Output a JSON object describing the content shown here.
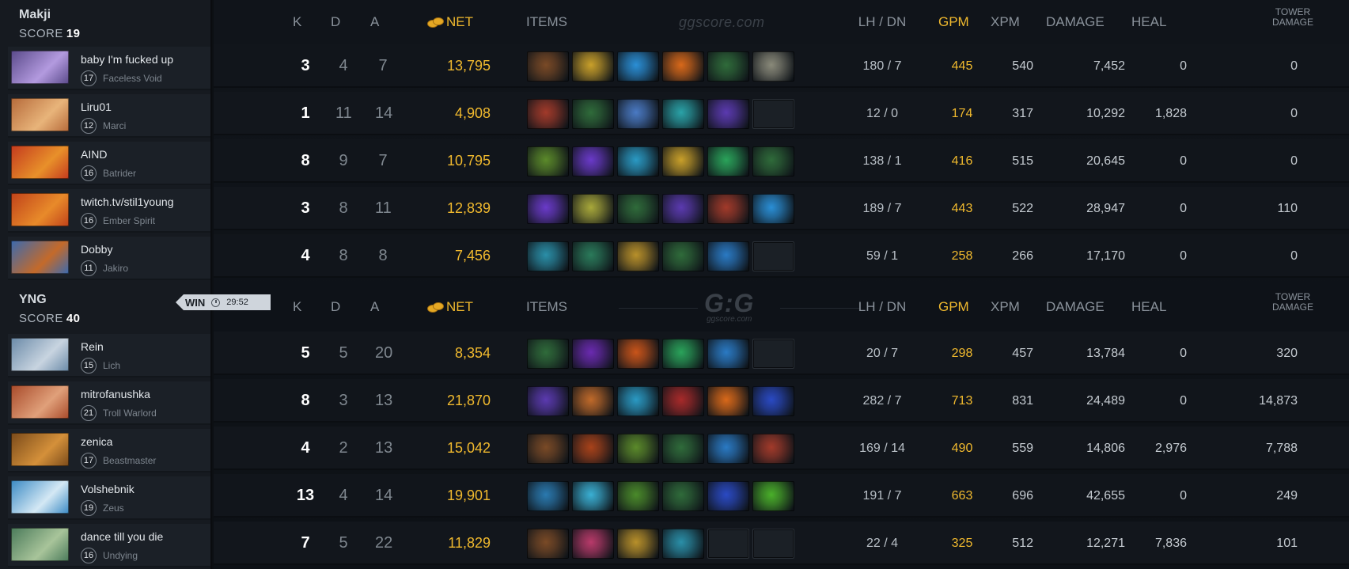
{
  "headers": {
    "k": "K",
    "d": "D",
    "a": "A",
    "net": "NET",
    "items": "ITEMS",
    "lhdn": "LH / DN",
    "gpm": "GPM",
    "xpm": "XPM",
    "damage": "DAMAGE",
    "heal": "HEAL",
    "tower_damage_1": "TOWER",
    "tower_damage_2": "DAMAGE",
    "watermark": "ggscore.com",
    "logo_big": "G:G",
    "logo_small": "ggscore.com"
  },
  "colors": {
    "gold": "#f0b92e",
    "sidebar": "#161a20",
    "background": "#0c0f13"
  },
  "win_tag": {
    "label": "WIN",
    "time": "29:52",
    "icon": "clock-icon"
  },
  "teams": [
    {
      "name": "Makji",
      "score_label": "SCORE",
      "score": "19",
      "players": [
        {
          "name": "baby I'm fucked up",
          "level": "17",
          "hero": "Faceless Void",
          "portrait": "#5a4a8a,#b39adf",
          "k": "3",
          "d": "4",
          "a": "7",
          "net": "13,795",
          "items": [
            "boots-item#7a4a26",
            "gold-helm-item#c9a02a",
            "blue-orb-item#2a8fd6",
            "fire-orb-item#d9691a",
            "green-dagger-item#2f6b3a",
            "scythe-item#8a8a7a"
          ],
          "lhdn": "180  /  7",
          "gpm": "445",
          "xpm": "540",
          "damage": "7,452",
          "heal": "0",
          "tower": "0"
        },
        {
          "name": "Liru01",
          "level": "12",
          "hero": "Marci",
          "portrait": "#b66a3a,#e8b47a",
          "k": "1",
          "d": "11",
          "a": "14",
          "net": "4,908",
          "items": [
            "axe-item#a23a2a",
            "green-dagger-item#2f6b3a",
            "potion-item#4a7ac4",
            "blob-item#2aa3a8",
            "purple-cloak-item#5b3ab0",
            "empty"
          ],
          "lhdn": "12  /  0",
          "gpm": "174",
          "xpm": "317",
          "damage": "10,292",
          "heal": "1,828",
          "tower": "0"
        },
        {
          "name": "AIND",
          "level": "16",
          "hero": "Batrider",
          "portrait": "#c43a1e,#e8902a",
          "k": "8",
          "d": "9",
          "a": "7",
          "net": "10,795",
          "items": [
            "lotus-item#5b8a2a",
            "purple-blade-item#6a3ac9",
            "ice-axe-item#2a9ac4",
            "gold-helm-item#c9a02a",
            "green-boots-item#2aa35a",
            "green-dagger-item#2f6b3a"
          ],
          "lhdn": "138  /  1",
          "gpm": "416",
          "xpm": "515",
          "damage": "20,645",
          "heal": "0",
          "tower": "0"
        },
        {
          "name": "twitch.tv/stil1young",
          "level": "16",
          "hero": "Ember Spirit",
          "portrait": "#c0421a,#e88a2a",
          "k": "3",
          "d": "8",
          "a": "11",
          "net": "12,839",
          "items": [
            "purple-blade-item#6a3ac9",
            "gear-item#a8a83a",
            "green-dagger-item#2f6b3a",
            "purple-cloak-item#5b3ab0",
            "axe-item#a23a2a",
            "blue-orb-item#2a8fd6"
          ],
          "lhdn": "189  /  7",
          "gpm": "443",
          "xpm": "522",
          "damage": "28,947",
          "heal": "0",
          "tower": "110"
        },
        {
          "name": "Dobby",
          "level": "11",
          "hero": "Jakiro",
          "portrait": "#3a6ab0,#c46a2a",
          "k": "4",
          "d": "8",
          "a": "8",
          "net": "7,456",
          "items": [
            "wave-item#2a8fa8",
            "staff-item#2a7a5a",
            "gold-mask-item#b8902a",
            "green-dagger-item#2f6b3a",
            "gem-item#2a7ac4",
            "empty"
          ],
          "lhdn": "59  /  1",
          "gpm": "258",
          "xpm": "266",
          "damage": "17,170",
          "heal": "0",
          "tower": "0"
        }
      ]
    },
    {
      "name": "YNG",
      "score_label": "SCORE",
      "score": "40",
      "players": [
        {
          "name": "Rein",
          "level": "15",
          "hero": "Lich",
          "portrait": "#6a8aa8,#c8d4e0",
          "k": "5",
          "d": "5",
          "a": "20",
          "net": "8,354",
          "items": [
            "green-dagger-item#2f6b3a",
            "purple-orb-item#6a2ab0",
            "mushroom-item#c9541a",
            "green-boots-item#2aa35a",
            "gem-item#2a7ac4",
            "empty"
          ],
          "lhdn": "20  /  7",
          "gpm": "298",
          "xpm": "457",
          "damage": "13,784",
          "heal": "0",
          "tower": "320"
        },
        {
          "name": "mitrofanushka",
          "level": "21",
          "hero": "Troll Warlord",
          "portrait": "#a84a2a,#e0a07a",
          "k": "8",
          "d": "3",
          "a": "13",
          "net": "21,870",
          "items": [
            "purple-cloak-item#5b3ab0",
            "axe-item#c06a2a",
            "ice-axe-item#2a9ac4",
            "armor-item#a82a2a",
            "fire-orb-item#d9691a",
            "spear-item#2a4ac4"
          ],
          "lhdn": "282  /  7",
          "gpm": "713",
          "xpm": "831",
          "damage": "24,489",
          "heal": "0",
          "tower": "14,873"
        },
        {
          "name": "zenica",
          "level": "17",
          "hero": "Beastmaster",
          "portrait": "#7a4a1a,#d4903a",
          "k": "4",
          "d": "2",
          "a": "13",
          "net": "15,042",
          "items": [
            "boots-item#7a4a26",
            "warrior-item#a8421a",
            "lotus-item#5b8a2a",
            "green-dagger-item#2f6b3a",
            "gem-item#2a7ac4",
            "axe-item#a23a2a"
          ],
          "lhdn": "169  /  14",
          "gpm": "490",
          "xpm": "559",
          "damage": "14,806",
          "heal": "2,976",
          "tower": "7,788"
        },
        {
          "name": "Volshebnik",
          "level": "19",
          "hero": "Zeus",
          "portrait": "#3a8ac4,#d4e8f4",
          "k": "13",
          "d": "4",
          "a": "14",
          "net": "19,901",
          "items": [
            "scroll-item#2a7ab0",
            "crystal-item#3ab0d4",
            "green-sword-item#4a8a2a",
            "green-dagger-item#2f6b3a",
            "spear-item#2a4ac4",
            "swirl-item#4ab02a"
          ],
          "lhdn": "191  /  7",
          "gpm": "663",
          "xpm": "696",
          "damage": "42,655",
          "heal": "0",
          "tower": "249"
        },
        {
          "name": "dance till you die",
          "level": "16",
          "hero": "Undying",
          "portrait": "#4a7a5a,#a8c49a",
          "k": "7",
          "d": "5",
          "a": "22",
          "net": "11,829",
          "items": [
            "boots-item#7a4a26",
            "pink-flower-item#b83a6a",
            "gold-staff-item#b8902a",
            "wave-item#2a8fa8",
            "empty",
            "empty"
          ],
          "lhdn": "22  /  4",
          "gpm": "325",
          "xpm": "512",
          "damage": "12,271",
          "heal": "7,836",
          "tower": "101"
        }
      ]
    }
  ]
}
